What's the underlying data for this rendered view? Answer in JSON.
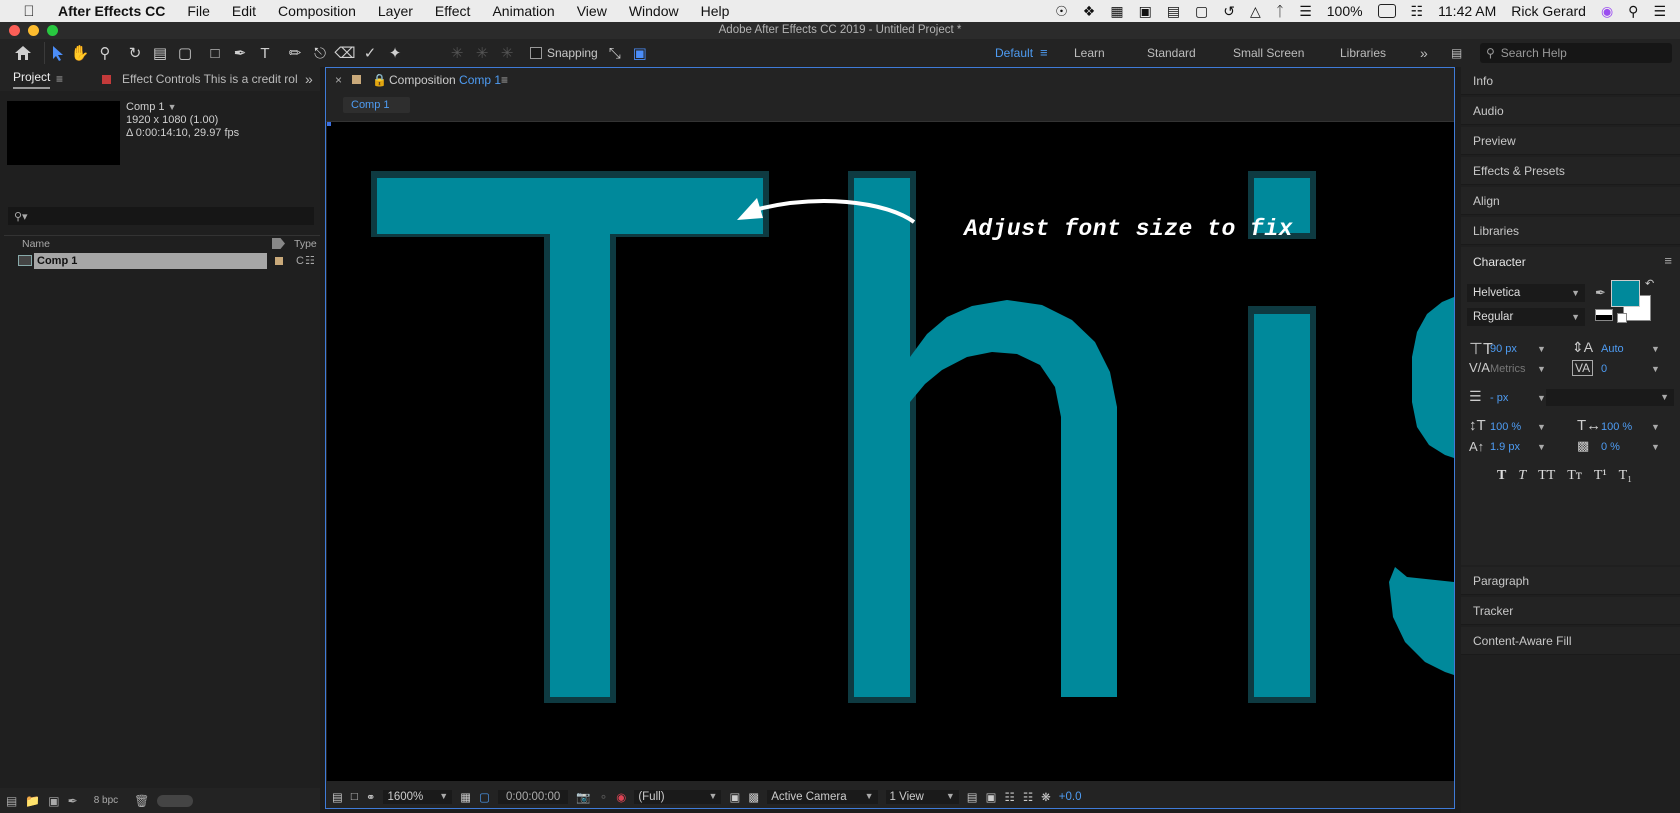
{
  "menubar": {
    "app_name": "After Effects CC",
    "items": [
      "File",
      "Edit",
      "Composition",
      "Layer",
      "Effect",
      "Animation",
      "View",
      "Window",
      "Help"
    ],
    "battery": "100%",
    "time": "11:42 AM",
    "user": "Rick Gerard"
  },
  "window": {
    "title": "Adobe After Effects CC 2019 - Untitled Project *"
  },
  "toolbar": {
    "snapping_label": "Snapping",
    "workspaces": [
      "Default",
      "Learn",
      "Standard",
      "Small Screen",
      "Libraries"
    ],
    "active_workspace": "Default",
    "search_placeholder": "Search Help"
  },
  "project_panel": {
    "tab_project": "Project",
    "tab_effect_controls": "Effect Controls This is a credit rol",
    "comp_name": "Comp 1",
    "comp_dims": "1920 x 1080 (1.00)",
    "comp_duration": "Δ 0:00:14:10, 29.97 fps",
    "search_placeholder": "",
    "col_name": "Name",
    "col_type": "Type",
    "row_name": "Comp 1",
    "row_type": "C",
    "bpc": "8 bpc"
  },
  "composition": {
    "tab_prefix": "Composition",
    "tab_name": "Comp 1",
    "sub_tab": "Comp 1",
    "annotation": "Adjust font size to fix",
    "text_color": "#00899b",
    "footer": {
      "zoom": "1600%",
      "timecode": "0:00:00:00",
      "resolution": "(Full)",
      "camera": "Active Camera",
      "views": "1 View",
      "exposure": "+0.0"
    }
  },
  "right_panel": {
    "collapsed_top": [
      "Info",
      "Audio",
      "Preview",
      "Effects & Presets",
      "Align",
      "Libraries"
    ],
    "character_title": "Character",
    "font_family": "Helvetica",
    "font_style": "Regular",
    "font_size": "90 px",
    "leading": "Auto",
    "kerning": "Metrics",
    "tracking": "0",
    "stroke_width": "- px",
    "vert_scale": "100 %",
    "horiz_scale": "100 %",
    "baseline_shift": "1.9 px",
    "tsume": "0 %",
    "fill_color": "#00899b",
    "style_buttons": [
      "T",
      "T",
      "TT",
      "Tт",
      "T¹",
      "T₁"
    ],
    "collapsed_bottom": [
      "Paragraph",
      "Tracker",
      "Content-Aware Fill"
    ]
  }
}
